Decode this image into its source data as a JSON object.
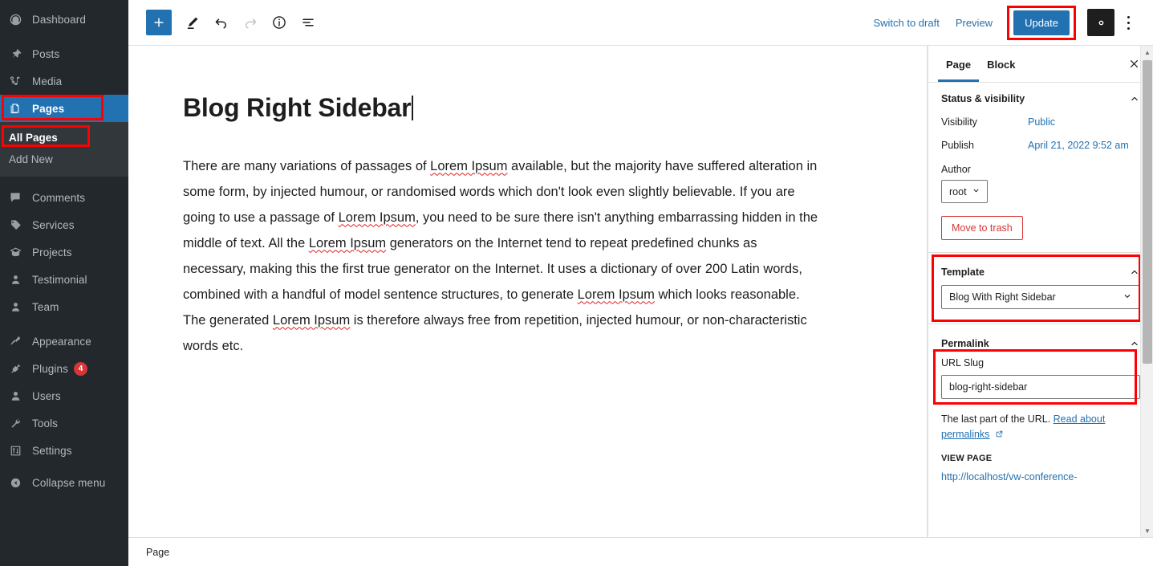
{
  "admin_sidebar": {
    "items": [
      {
        "label": "Dashboard",
        "icon": "dashboard-icon",
        "type": "item"
      },
      {
        "type": "sep"
      },
      {
        "label": "Posts",
        "icon": "pin-icon",
        "type": "item"
      },
      {
        "label": "Media",
        "icon": "media-icon",
        "type": "item"
      },
      {
        "label": "Pages",
        "icon": "pages-icon",
        "type": "item",
        "active": true,
        "highlighted": true
      },
      {
        "label": "Comments",
        "icon": "comment-icon",
        "type": "item"
      },
      {
        "label": "Services",
        "icon": "tag-icon",
        "type": "item"
      },
      {
        "label": "Projects",
        "icon": "projects-icon",
        "type": "item"
      },
      {
        "label": "Testimonial",
        "icon": "person-icon",
        "type": "item"
      },
      {
        "label": "Team",
        "icon": "person-icon",
        "type": "item"
      },
      {
        "type": "sep"
      },
      {
        "label": "Appearance",
        "icon": "brush-icon",
        "type": "item"
      },
      {
        "label": "Plugins",
        "icon": "plug-icon",
        "type": "item",
        "badge": "4"
      },
      {
        "label": "Users",
        "icon": "users-icon",
        "type": "item"
      },
      {
        "label": "Tools",
        "icon": "wrench-icon",
        "type": "item"
      },
      {
        "label": "Settings",
        "icon": "sliders-icon",
        "type": "item"
      },
      {
        "label": "Collapse menu",
        "icon": "collapse-icon",
        "type": "item"
      }
    ],
    "submenu": [
      {
        "label": "All Pages",
        "current": true,
        "highlighted": true
      },
      {
        "label": "Add New",
        "current": false
      }
    ]
  },
  "toolbar": {
    "add_block_label": "+",
    "tools": [
      {
        "name": "edit-pencil-icon",
        "title": "Tools"
      },
      {
        "name": "undo-icon",
        "title": "Undo"
      },
      {
        "name": "redo-icon",
        "title": "Redo"
      },
      {
        "name": "info-icon",
        "title": "Details"
      },
      {
        "name": "list-view-icon",
        "title": "List view"
      }
    ],
    "switch_to_draft": "Switch to draft",
    "preview": "Preview",
    "update": "Update",
    "settings_gear": "gear-icon",
    "more_options": "kebab-menu-icon"
  },
  "editor": {
    "title": "Blog Right Sidebar",
    "paragraph_parts": [
      {
        "t": "There are many variations of passages of ",
        "spell": false
      },
      {
        "t": "Lorem Ipsum",
        "spell": true
      },
      {
        "t": " available, but the majority have suffered alteration in some form, by injected humour, or randomised words which don't look even slightly believable. If you are going to use a passage of ",
        "spell": false
      },
      {
        "t": "Lorem Ipsum",
        "spell": true
      },
      {
        "t": ", you need to be sure there isn't anything embarrassing hidden in the middle of text. All the ",
        "spell": false
      },
      {
        "t": "Lorem Ipsum",
        "spell": true
      },
      {
        "t": " generators on the Internet tend to repeat predefined chunks as necessary, making this the first true generator on the Internet. It uses a dictionary of over 200 Latin words, combined with a handful of model sentence structures, to generate ",
        "spell": false
      },
      {
        "t": "Lorem Ipsum",
        "spell": true
      },
      {
        "t": " which looks reasonable. The generated ",
        "spell": false
      },
      {
        "t": "Lorem Ipsum",
        "spell": true
      },
      {
        "t": " is therefore always free from repetition, injected humour, or non-characteristic words etc.",
        "spell": false
      }
    ],
    "status_bar": "Page"
  },
  "settings_panel": {
    "tabs": [
      {
        "label": "Page",
        "selected": true
      },
      {
        "label": "Block",
        "selected": false
      }
    ],
    "close_icon": "close-icon",
    "status_visibility": {
      "title": "Status & visibility",
      "visibility_label": "Visibility",
      "visibility_value": "Public",
      "publish_label": "Publish",
      "publish_value": "April 21, 2022 9:52 am",
      "author_label": "Author",
      "author_value": "root",
      "move_to_trash": "Move to trash"
    },
    "template": {
      "title": "Template",
      "value": "Blog With Right Sidebar",
      "highlighted": true
    },
    "permalink": {
      "title": "Permalink",
      "url_slug_label": "URL Slug",
      "url_slug_value": "blog-right-sidebar",
      "hint_text": "The last part of the URL. ",
      "hint_link": "Read about permalinks",
      "view_page_caption": "VIEW PAGE",
      "view_page_url": "http://localhost/vw-conference-",
      "highlighted": true
    }
  },
  "colors": {
    "accent": "#2271b1",
    "highlight": "#ff0000",
    "sidebar_bg": "#23282d",
    "submenu_bg": "#32373c",
    "danger": "#d63638"
  }
}
